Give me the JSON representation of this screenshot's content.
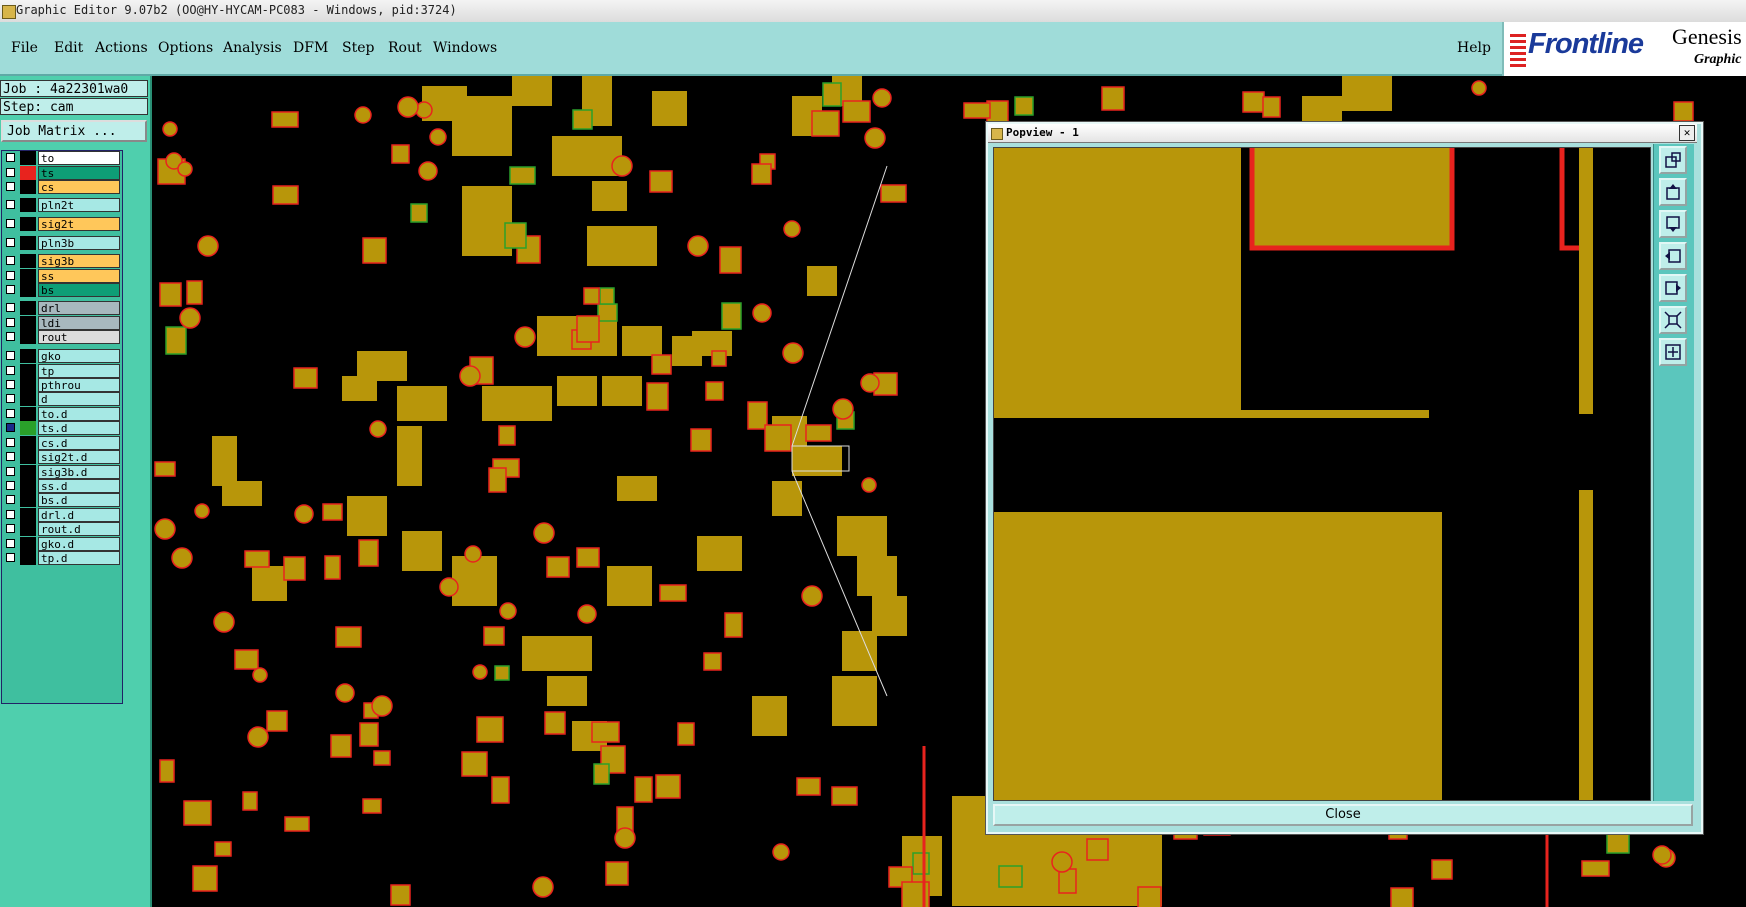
{
  "window": {
    "title": "Graphic Editor 9.07b2 (OO@HY-HYCAM-PC083 - Windows, pid:3724)"
  },
  "menu": [
    {
      "label": "File"
    },
    {
      "label": "Edit"
    },
    {
      "label": "Actions"
    },
    {
      "label": "Options"
    },
    {
      "label": "Analysis"
    },
    {
      "label": "DFM"
    },
    {
      "label": "Step"
    },
    {
      "label": "Rout"
    },
    {
      "label": "Windows"
    },
    {
      "label": "Help"
    }
  ],
  "brand": {
    "logo": "Frontline",
    "product": "Genesis",
    "subtitle": "Graphic"
  },
  "job": {
    "job_line": "Job : 4a22301wa0",
    "step_line": "Step: cam",
    "matrix_button": "Job Matrix ..."
  },
  "layers": [
    {
      "name": "to",
      "bg": "#ffffff",
      "swatch": "#000000"
    },
    {
      "name": "ts",
      "bg": "#0e9e76",
      "swatch": "#e8231e"
    },
    {
      "name": "cs",
      "bg": "#ffc75a",
      "swatch": "#000000"
    },
    {
      "name": "pln2t",
      "bg": "#a6e8e4",
      "swatch": "#000000"
    },
    {
      "name": "sig2t",
      "bg": "#ffc75a",
      "swatch": "#000000"
    },
    {
      "name": "pln3b",
      "bg": "#a6e8e4",
      "swatch": "#000000"
    },
    {
      "name": "sig3b",
      "bg": "#ffc75a",
      "swatch": "#000000"
    },
    {
      "name": "ss",
      "bg": "#ffc75a",
      "swatch": "#000000"
    },
    {
      "name": "bs",
      "bg": "#0e9e76",
      "swatch": "#000000"
    },
    {
      "name": "drl",
      "bg": "#a8b8be",
      "swatch": "#000000"
    },
    {
      "name": "ldi",
      "bg": "#a8b8be",
      "swatch": "#000000"
    },
    {
      "name": "rout",
      "bg": "#dcdcdc",
      "swatch": "#000000"
    },
    {
      "name": "gko",
      "bg": "#a6e8e4",
      "swatch": "#000000"
    },
    {
      "name": "tp",
      "bg": "#a6e8e4",
      "swatch": "#000000"
    },
    {
      "name": "pthrou",
      "bg": "#a6e8e4",
      "swatch": "#000000"
    },
    {
      "name": "d",
      "bg": "#a6e8e4",
      "swatch": "#000000"
    },
    {
      "name": "to.d",
      "bg": "#a6e8e4",
      "swatch": "#000000"
    },
    {
      "name": "ts.d",
      "bg": "#a6e8e4",
      "swatch": "#2aa02a",
      "checked": true
    },
    {
      "name": "cs.d",
      "bg": "#a6e8e4",
      "swatch": "#000000"
    },
    {
      "name": "sig2t.d",
      "bg": "#a6e8e4",
      "swatch": "#000000"
    },
    {
      "name": "sig3b.d",
      "bg": "#a6e8e4",
      "swatch": "#000000"
    },
    {
      "name": "ss.d",
      "bg": "#a6e8e4",
      "swatch": "#000000"
    },
    {
      "name": "bs.d",
      "bg": "#a6e8e4",
      "swatch": "#000000"
    },
    {
      "name": "drl.d",
      "bg": "#a6e8e4",
      "swatch": "#000000"
    },
    {
      "name": "rout.d",
      "bg": "#a6e8e4",
      "swatch": "#000000"
    },
    {
      "name": "gko.d",
      "bg": "#a6e8e4",
      "swatch": "#000000"
    },
    {
      "name": "tp.d",
      "bg": "#a6e8e4",
      "swatch": "#000000"
    }
  ],
  "popview": {
    "title": "Popview - 1",
    "close_label": "Close"
  },
  "colors": {
    "pad": "#b8960a",
    "outline": "#e8231e",
    "accent_green": "#2aa02a",
    "panel": "#9fdcd9"
  }
}
